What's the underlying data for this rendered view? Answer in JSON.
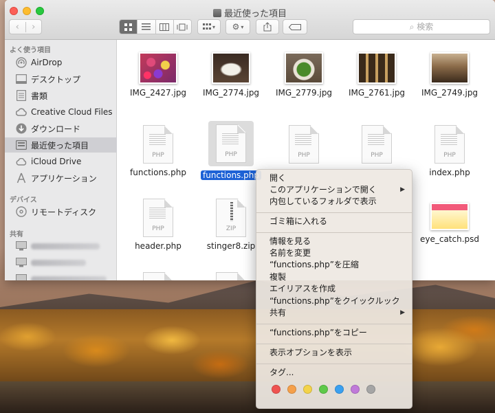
{
  "window": {
    "title": "最近使った項目"
  },
  "toolbar": {
    "back_icon": "‹",
    "forward_icon": "›",
    "search_placeholder": "検索"
  },
  "sidebar": {
    "favorites_header": "よく使う項目",
    "favorites": [
      {
        "label": "AirDrop",
        "icon": "airdrop-icon"
      },
      {
        "label": "デスクトップ",
        "icon": "desktop-icon"
      },
      {
        "label": "書類",
        "icon": "documents-icon"
      },
      {
        "label": "Creative Cloud Files",
        "icon": "creative-cloud-icon"
      },
      {
        "label": "ダウンロード",
        "icon": "downloads-icon"
      },
      {
        "label": "最近使った項目",
        "icon": "recents-icon"
      },
      {
        "label": "iCloud Drive",
        "icon": "icloud-icon"
      },
      {
        "label": "アプリケーション",
        "icon": "applications-icon"
      }
    ],
    "devices_header": "デバイス",
    "devices": [
      {
        "label": "リモートディスク",
        "icon": "remote-disc-icon"
      }
    ],
    "shared_header": "共有"
  },
  "files": [
    {
      "name": "IMG_2427.jpg",
      "kind": "photo"
    },
    {
      "name": "IMG_2774.jpg",
      "kind": "photo"
    },
    {
      "name": "IMG_2779.jpg",
      "kind": "photo"
    },
    {
      "name": "IMG_2761.jpg",
      "kind": "photo"
    },
    {
      "name": "IMG_2749.jpg",
      "kind": "photo"
    },
    {
      "name": "functions.php",
      "kind": "php",
      "ext": "PHP"
    },
    {
      "name": "functions.php",
      "kind": "php",
      "ext": "PHP",
      "selected": true
    },
    {
      "name": "index.php",
      "kind": "php",
      "ext": "PHP"
    },
    {
      "name": "header.php",
      "kind": "php",
      "ext": "PHP"
    },
    {
      "name": "stinger8.zip",
      "kind": "zip",
      "ext": "ZIP"
    },
    {
      "name": "eye_catch.psd",
      "kind": "psd"
    }
  ],
  "context_menu": {
    "items": [
      "開く",
      "このアプリケーションで開く",
      "内包しているフォルダで表示",
      "ゴミ箱に入れる",
      "情報を見る",
      "名前を変更",
      "“functions.php”を圧縮",
      "複製",
      "エイリアスを作成",
      "“functions.php”をクイックルック",
      "共有",
      "“functions.php”をコピー",
      "表示オプションを表示",
      "タグ..."
    ],
    "submenu_arrow": "▶",
    "tag_colors": [
      "#ef5350",
      "#f5a04a",
      "#f3d34a",
      "#5ec94a",
      "#3aa0f0",
      "#c07ad9",
      "#a5a5a5"
    ]
  }
}
